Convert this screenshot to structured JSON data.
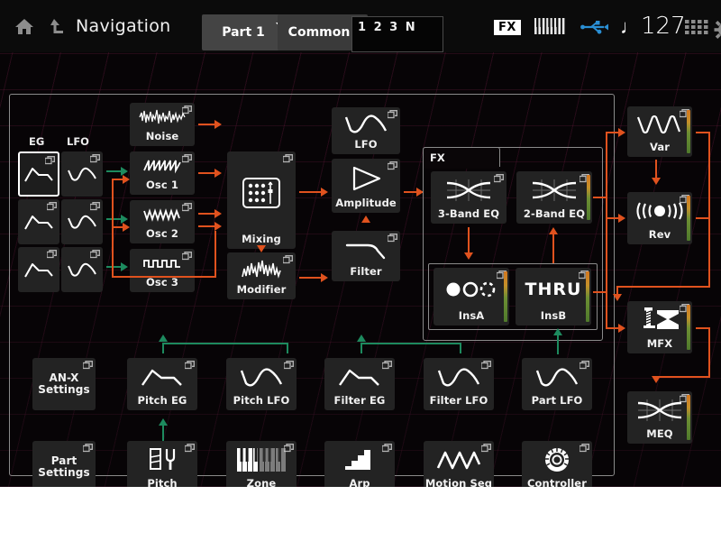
{
  "header": {
    "home_icon": "home-icon",
    "back_icon": "back-up-icon",
    "title": "Navigation",
    "part_selector": "Part 1",
    "mode_selector": "Common",
    "code_display": "1 2 3 N",
    "fx_badge": "FX",
    "keyboard_icon": "keyboard-icon",
    "usb_icon": "usb-icon",
    "tempo": "127",
    "tempo_note": "♩",
    "grid_icon": "grid-icon",
    "gear_icon": "gear-icon"
  },
  "columns": {
    "eg_header": "EG",
    "lfo_header": "LFO"
  },
  "mod_blocks": [
    {
      "name": "eg-1",
      "label": "",
      "icon": "eg-envelope-icon",
      "selected": true
    },
    {
      "name": "lfo-1",
      "label": "",
      "icon": "lfo-wave-icon",
      "selected": false
    },
    {
      "name": "eg-2",
      "label": "",
      "icon": "eg-envelope-icon",
      "selected": false
    },
    {
      "name": "lfo-2",
      "label": "",
      "icon": "lfo-wave-icon",
      "selected": false
    },
    {
      "name": "eg-3",
      "label": "",
      "icon": "eg-envelope-icon",
      "selected": false
    },
    {
      "name": "lfo-3",
      "label": "",
      "icon": "lfo-wave-icon",
      "selected": false
    }
  ],
  "sources": [
    {
      "label": "Noise",
      "icon": "noise-waveform-icon"
    },
    {
      "label": "Osc 1",
      "icon": "sawtooth-wave-icon"
    },
    {
      "label": "Osc 2",
      "icon": "triangle-wave-icon"
    },
    {
      "label": "Osc 3",
      "icon": "square-wave-icon"
    }
  ],
  "mixer": [
    {
      "label": "Mixing",
      "icon": "mixer-matrix-icon"
    },
    {
      "label": "Modifier",
      "icon": "modifier-waveform-icon"
    }
  ],
  "amp_chain": [
    {
      "label": "LFO",
      "icon": "lfo-wave-icon"
    },
    {
      "label": "Amplitude",
      "icon": "amplifier-triangle-icon"
    },
    {
      "label": "Filter",
      "icon": "filter-curve-icon"
    }
  ],
  "fx": {
    "tab_label": "FX",
    "blocks": [
      {
        "label": "3-Band EQ",
        "icon": "eq-curve-icon",
        "meter": false
      },
      {
        "label": "2-Band EQ",
        "icon": "eq-curve-icon",
        "meter": true
      },
      {
        "label": "InsA",
        "icon": "circles-icon",
        "meter": true
      },
      {
        "label": "InsB",
        "icon": "thru-text",
        "meter": true,
        "icon_text": "THRU"
      }
    ]
  },
  "master_chain": [
    {
      "label": "Var",
      "icon": "variation-wave-icon",
      "meter": true
    },
    {
      "label": "Rev",
      "icon": "reverb-icon",
      "meter": true
    },
    {
      "label": "MFX",
      "icon": "compressor-icon",
      "meter": true
    },
    {
      "label": "MEQ",
      "icon": "eq-curve-icon",
      "meter": true
    }
  ],
  "settings_blocks": [
    {
      "label": "AN-X\nSettings",
      "line1": "AN-X",
      "line2": "Settings"
    },
    {
      "label": "Part\nSettings",
      "line1": "Part",
      "line2": "Settings"
    }
  ],
  "bottom_row_1": [
    {
      "label": "Pitch EG",
      "icon": "eg-envelope-icon"
    },
    {
      "label": "Pitch LFO",
      "icon": "lfo-wave-icon"
    },
    {
      "label": "Filter EG",
      "icon": "eg-envelope-icon"
    },
    {
      "label": "Filter LFO",
      "icon": "lfo-wave-icon"
    },
    {
      "label": "Part LFO",
      "icon": "lfo-wave-icon"
    }
  ],
  "bottom_row_2": [
    {
      "label": "Pitch",
      "icon": "tuning-fork-icon"
    },
    {
      "label": "Zone",
      "icon": "keyboard-zone-icon"
    },
    {
      "label": "Arp",
      "icon": "arpeggio-stairs-icon"
    },
    {
      "label": "Motion Seq",
      "icon": "motion-seq-icon"
    },
    {
      "label": "Controller",
      "icon": "knob-icon"
    }
  ],
  "colors": {
    "signal_orange": "#e0521e",
    "mod_green": "#1d8a5e",
    "block_bg": "#232323",
    "screen_bg": "#0a0608",
    "accent_white": "#ffffff"
  }
}
